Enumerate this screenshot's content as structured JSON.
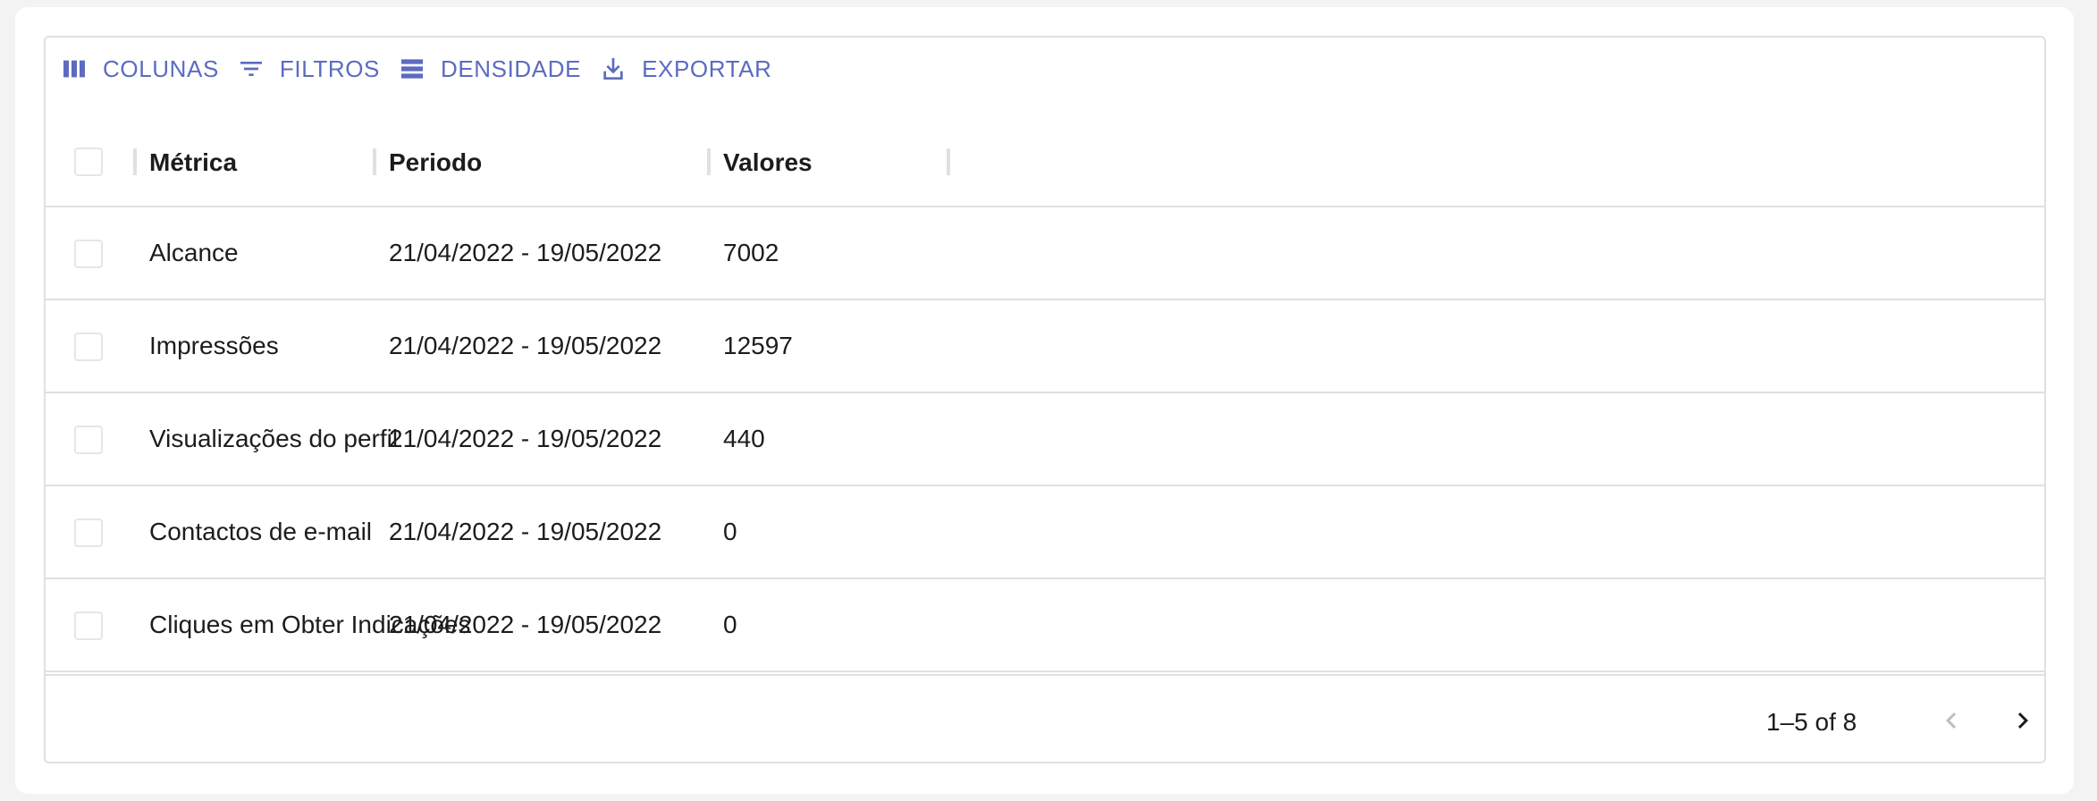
{
  "toolbar": {
    "columns_label": "COLUNAS",
    "filters_label": "FILTROS",
    "density_label": "DENSIDADE",
    "export_label": "EXPORTAR",
    "accent_color": "#5c6bc0"
  },
  "table": {
    "headers": [
      "Métrica",
      "Periodo",
      "Valores"
    ],
    "rows": [
      {
        "metric": "Alcance",
        "period": "21/04/2022 - 19/05/2022",
        "value": "7002"
      },
      {
        "metric": "Impressões",
        "period": "21/04/2022 - 19/05/2022",
        "value": "12597"
      },
      {
        "metric": "Visualizações do perfil",
        "period": "21/04/2022 - 19/05/2022",
        "value": "440"
      },
      {
        "metric": "Contactos de e-mail",
        "period": "21/04/2022 - 19/05/2022",
        "value": "0"
      },
      {
        "metric": "Cliques em Obter Indicações",
        "period": "21/04/2022 - 19/05/2022",
        "value": "0"
      }
    ]
  },
  "pagination": {
    "label": "1–5 of 8"
  },
  "icons": {
    "columns": "view-column-icon",
    "filters": "filter-list-icon",
    "density": "density-icon",
    "export": "download-icon",
    "prev": "chevron-left-icon",
    "next": "chevron-right-icon"
  }
}
